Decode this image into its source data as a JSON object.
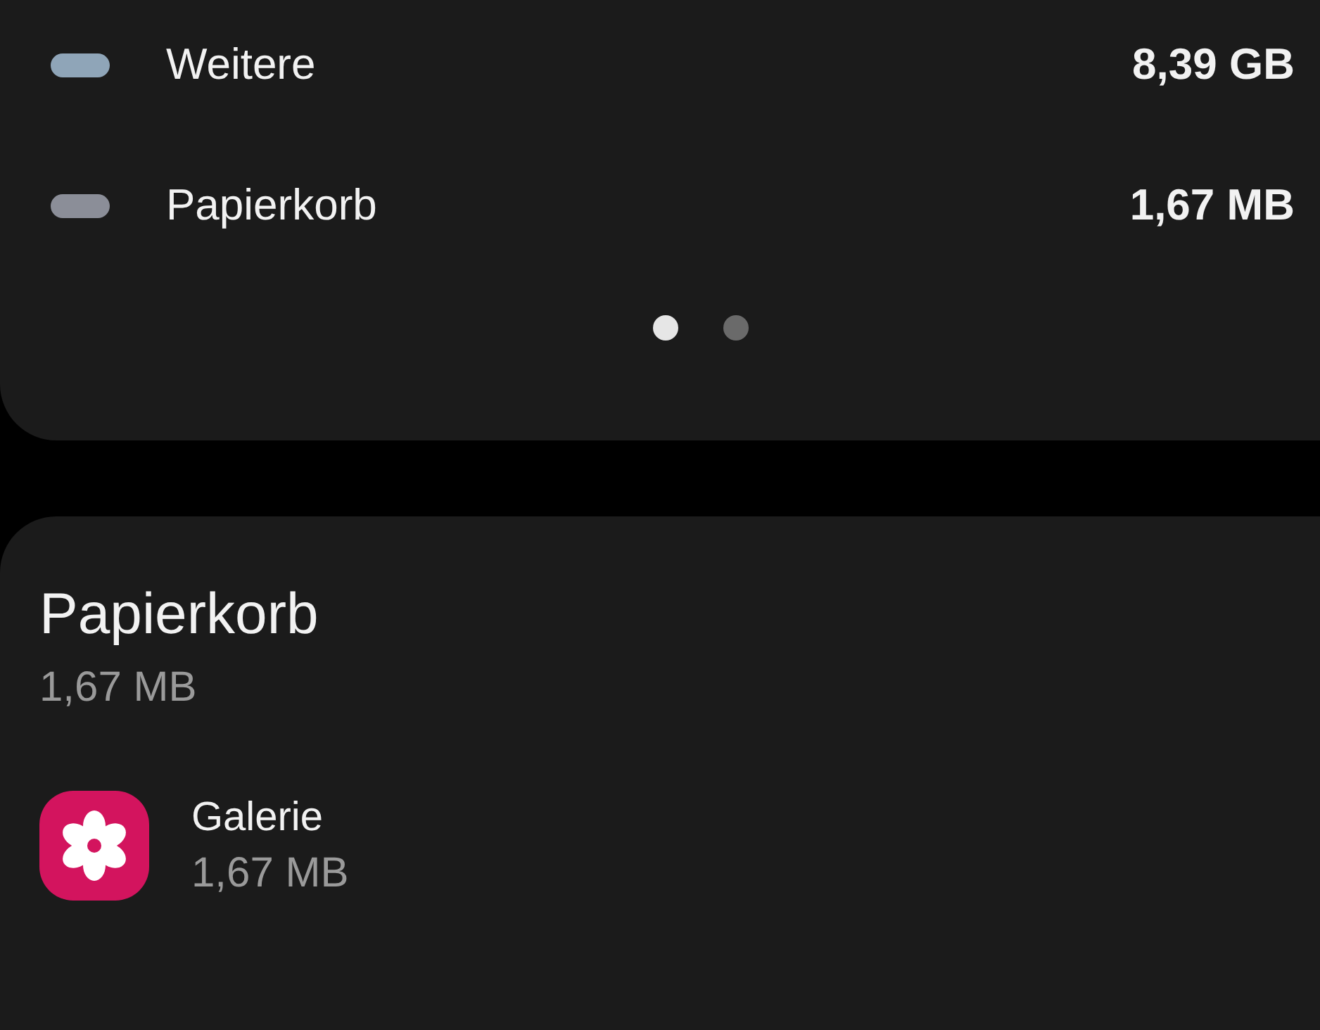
{
  "legend": [
    {
      "label": "Weitere",
      "value": "8,39 GB",
      "color": "#8fa5b8"
    },
    {
      "label": "Papierkorb",
      "value": "1,67 MB",
      "color": "#8b8e98"
    }
  ],
  "pages": [
    {
      "selected": true
    },
    {
      "selected": false
    }
  ],
  "section": {
    "title": "Papierkorb",
    "size": "1,67 MB",
    "apps": [
      {
        "name": "Galerie",
        "size": "1,67 MB"
      }
    ]
  }
}
